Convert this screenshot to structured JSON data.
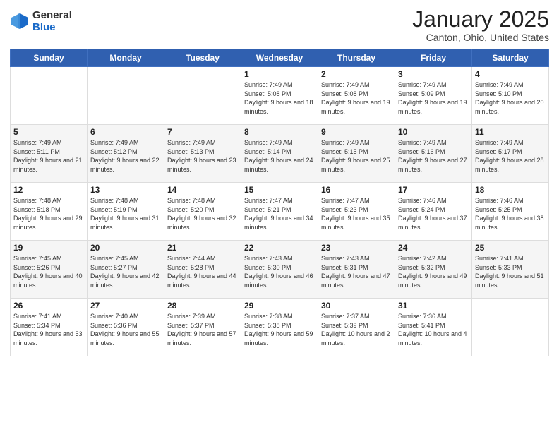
{
  "header": {
    "logo_general": "General",
    "logo_blue": "Blue",
    "month_title": "January 2025",
    "location": "Canton, Ohio, United States"
  },
  "days_of_week": [
    "Sunday",
    "Monday",
    "Tuesday",
    "Wednesday",
    "Thursday",
    "Friday",
    "Saturday"
  ],
  "weeks": [
    [
      {
        "day": "",
        "info": ""
      },
      {
        "day": "",
        "info": ""
      },
      {
        "day": "",
        "info": ""
      },
      {
        "day": "1",
        "info": "Sunrise: 7:49 AM\nSunset: 5:08 PM\nDaylight: 9 hours\nand 18 minutes."
      },
      {
        "day": "2",
        "info": "Sunrise: 7:49 AM\nSunset: 5:08 PM\nDaylight: 9 hours\nand 19 minutes."
      },
      {
        "day": "3",
        "info": "Sunrise: 7:49 AM\nSunset: 5:09 PM\nDaylight: 9 hours\nand 19 minutes."
      },
      {
        "day": "4",
        "info": "Sunrise: 7:49 AM\nSunset: 5:10 PM\nDaylight: 9 hours\nand 20 minutes."
      }
    ],
    [
      {
        "day": "5",
        "info": "Sunrise: 7:49 AM\nSunset: 5:11 PM\nDaylight: 9 hours\nand 21 minutes."
      },
      {
        "day": "6",
        "info": "Sunrise: 7:49 AM\nSunset: 5:12 PM\nDaylight: 9 hours\nand 22 minutes."
      },
      {
        "day": "7",
        "info": "Sunrise: 7:49 AM\nSunset: 5:13 PM\nDaylight: 9 hours\nand 23 minutes."
      },
      {
        "day": "8",
        "info": "Sunrise: 7:49 AM\nSunset: 5:14 PM\nDaylight: 9 hours\nand 24 minutes."
      },
      {
        "day": "9",
        "info": "Sunrise: 7:49 AM\nSunset: 5:15 PM\nDaylight: 9 hours\nand 25 minutes."
      },
      {
        "day": "10",
        "info": "Sunrise: 7:49 AM\nSunset: 5:16 PM\nDaylight: 9 hours\nand 27 minutes."
      },
      {
        "day": "11",
        "info": "Sunrise: 7:49 AM\nSunset: 5:17 PM\nDaylight: 9 hours\nand 28 minutes."
      }
    ],
    [
      {
        "day": "12",
        "info": "Sunrise: 7:48 AM\nSunset: 5:18 PM\nDaylight: 9 hours\nand 29 minutes."
      },
      {
        "day": "13",
        "info": "Sunrise: 7:48 AM\nSunset: 5:19 PM\nDaylight: 9 hours\nand 31 minutes."
      },
      {
        "day": "14",
        "info": "Sunrise: 7:48 AM\nSunset: 5:20 PM\nDaylight: 9 hours\nand 32 minutes."
      },
      {
        "day": "15",
        "info": "Sunrise: 7:47 AM\nSunset: 5:21 PM\nDaylight: 9 hours\nand 34 minutes."
      },
      {
        "day": "16",
        "info": "Sunrise: 7:47 AM\nSunset: 5:23 PM\nDaylight: 9 hours\nand 35 minutes."
      },
      {
        "day": "17",
        "info": "Sunrise: 7:46 AM\nSunset: 5:24 PM\nDaylight: 9 hours\nand 37 minutes."
      },
      {
        "day": "18",
        "info": "Sunrise: 7:46 AM\nSunset: 5:25 PM\nDaylight: 9 hours\nand 38 minutes."
      }
    ],
    [
      {
        "day": "19",
        "info": "Sunrise: 7:45 AM\nSunset: 5:26 PM\nDaylight: 9 hours\nand 40 minutes."
      },
      {
        "day": "20",
        "info": "Sunrise: 7:45 AM\nSunset: 5:27 PM\nDaylight: 9 hours\nand 42 minutes."
      },
      {
        "day": "21",
        "info": "Sunrise: 7:44 AM\nSunset: 5:28 PM\nDaylight: 9 hours\nand 44 minutes."
      },
      {
        "day": "22",
        "info": "Sunrise: 7:43 AM\nSunset: 5:30 PM\nDaylight: 9 hours\nand 46 minutes."
      },
      {
        "day": "23",
        "info": "Sunrise: 7:43 AM\nSunset: 5:31 PM\nDaylight: 9 hours\nand 47 minutes."
      },
      {
        "day": "24",
        "info": "Sunrise: 7:42 AM\nSunset: 5:32 PM\nDaylight: 9 hours\nand 49 minutes."
      },
      {
        "day": "25",
        "info": "Sunrise: 7:41 AM\nSunset: 5:33 PM\nDaylight: 9 hours\nand 51 minutes."
      }
    ],
    [
      {
        "day": "26",
        "info": "Sunrise: 7:41 AM\nSunset: 5:34 PM\nDaylight: 9 hours\nand 53 minutes."
      },
      {
        "day": "27",
        "info": "Sunrise: 7:40 AM\nSunset: 5:36 PM\nDaylight: 9 hours\nand 55 minutes."
      },
      {
        "day": "28",
        "info": "Sunrise: 7:39 AM\nSunset: 5:37 PM\nDaylight: 9 hours\nand 57 minutes."
      },
      {
        "day": "29",
        "info": "Sunrise: 7:38 AM\nSunset: 5:38 PM\nDaylight: 9 hours\nand 59 minutes."
      },
      {
        "day": "30",
        "info": "Sunrise: 7:37 AM\nSunset: 5:39 PM\nDaylight: 10 hours\nand 2 minutes."
      },
      {
        "day": "31",
        "info": "Sunrise: 7:36 AM\nSunset: 5:41 PM\nDaylight: 10 hours\nand 4 minutes."
      },
      {
        "day": "",
        "info": ""
      }
    ]
  ]
}
